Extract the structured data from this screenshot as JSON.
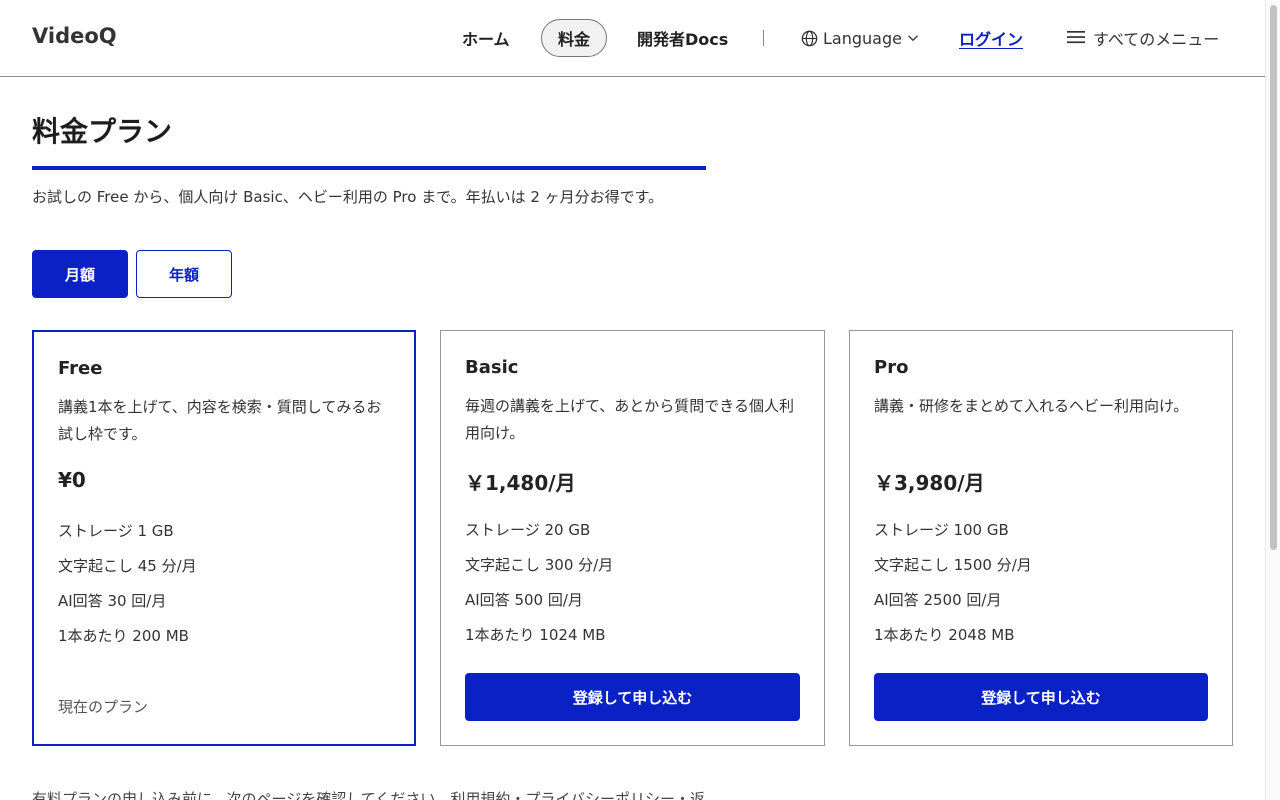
{
  "header": {
    "logo": "VideoQ",
    "nav": {
      "home": "ホーム",
      "pricing": "料金",
      "docs": "開発者Docs"
    },
    "language": "Language",
    "login": "ログイン",
    "menu": "すべてのメニュー"
  },
  "page": {
    "title": "料金プラン",
    "lead": "お試しの Free から、個人向け Basic、ヘビー利用の Pro まで。年払いは 2 ヶ月分お得です。"
  },
  "billing_toggle": {
    "monthly": "月額",
    "yearly": "年額",
    "selected": "月額"
  },
  "plans": [
    {
      "name": "Free",
      "desc": "講義1本を上げて、内容を検索・質問してみるお試し枠です。",
      "price": "¥0",
      "features": [
        "ストレージ 1 GB",
        "文字起こし 45 分/月",
        "AI回答 30 回/月",
        "1本あたり 200 MB"
      ],
      "action": "現在のプラン"
    },
    {
      "name": "Basic",
      "desc": "毎週の講義を上げて、あとから質問できる個人利用向け。",
      "price": "￥1,480/月",
      "features": [
        "ストレージ 20 GB",
        "文字起こし 300 分/月",
        "AI回答 500 回/月",
        "1本あたり 1024 MB"
      ],
      "action": "登録して申し込む"
    },
    {
      "name": "Pro",
      "desc": "講義・研修をまとめて入れるヘビー利用向け。",
      "price": "￥3,980/月",
      "features": [
        "ストレージ 100 GB",
        "文字起こし 1500 分/月",
        "AI回答 2500 回/月",
        "1本あたり 2048 MB"
      ],
      "action": "登録して申し込む"
    }
  ],
  "footnote": "有料プランの申し込み前に、次のページを確認してください。利用規約・プライバシーポリシー・返",
  "colors": {
    "accent": "#0a22c5",
    "border": "#9a9a9a"
  },
  "icons": {
    "language": "globe-icon",
    "menu": "hamburger-icon",
    "dropdown": "chevron-down-icon"
  }
}
